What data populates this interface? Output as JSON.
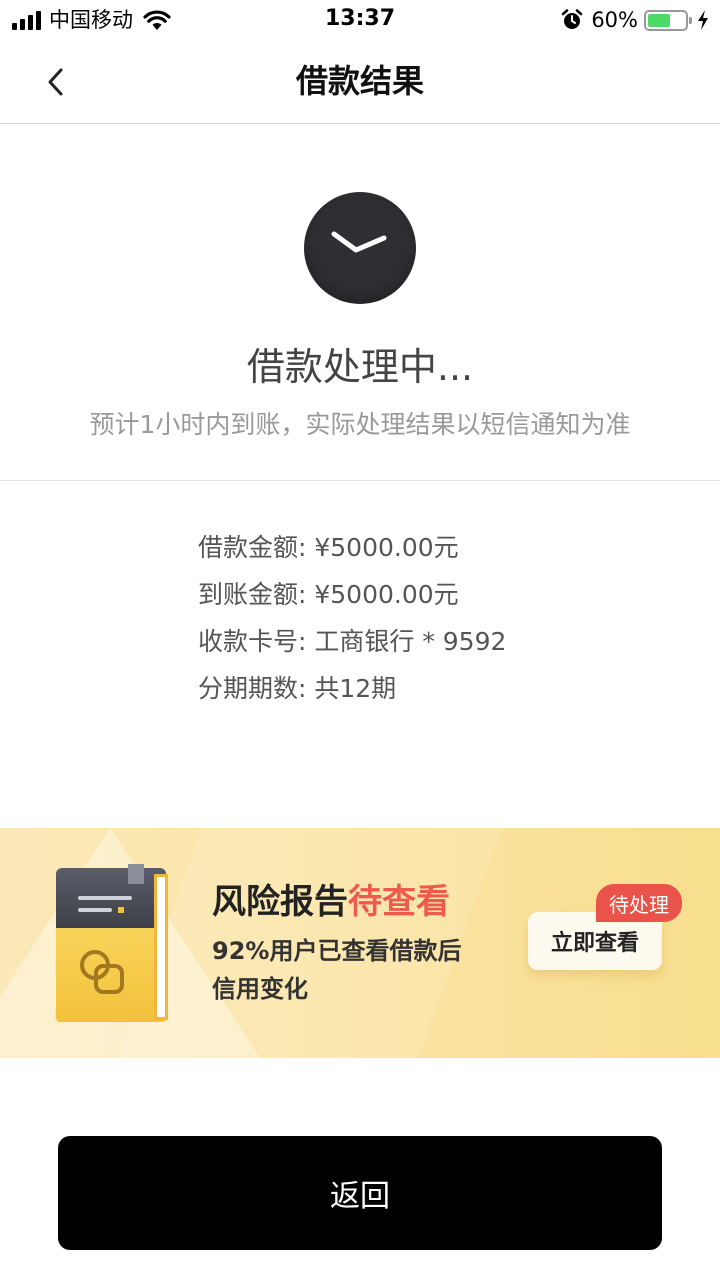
{
  "status_bar": {
    "carrier": "中国移动",
    "time": "13:37",
    "battery": "60%",
    "battery_level": 0.6,
    "icons": [
      "signal-icon",
      "wifi-icon",
      "alarm-icon",
      "battery-icon",
      "charging-icon"
    ]
  },
  "nav": {
    "title": "借款结果",
    "back_icon": "chevron-left-icon"
  },
  "status": {
    "icon": "clock-icon",
    "title": "借款处理中...",
    "description": "预计1小时内到账，实际处理结果以短信通知为准"
  },
  "details": [
    {
      "text": "借款金额: ¥5000.00元"
    },
    {
      "text": "到账金额: ¥5000.00元"
    },
    {
      "text": "收款卡号: 工商银行 * 9592"
    },
    {
      "text": "分期期数: 共12期"
    }
  ],
  "banner": {
    "title_main": "风险报告",
    "title_highlight": "待查看",
    "subtitle_line1": "92%用户已查看借款后",
    "subtitle_line2": "信用变化",
    "button_label": "立即查看",
    "badge": "待处理",
    "highlight_color": "#f05a4a"
  },
  "return_button": {
    "label": "返回"
  }
}
